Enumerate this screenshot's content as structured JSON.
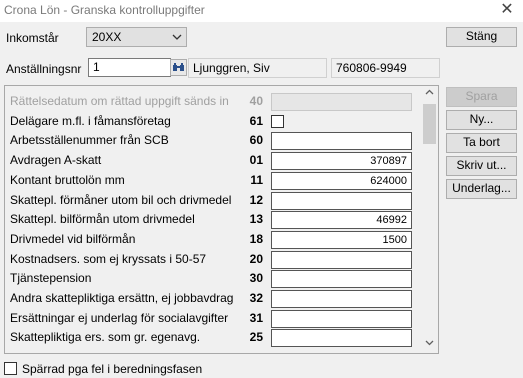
{
  "window": {
    "title": "Crona Lön - Granska kontrolluppgifter",
    "close_glyph": "✕"
  },
  "header": {
    "income_year_label": "Inkomstår",
    "income_year_value": "20XX",
    "close_button": "Stäng",
    "employee_no_label": "Anställningsnr",
    "employee_no_value": "1",
    "employee_name": "Ljunggren, Siv",
    "personal_id": "760806-9949"
  },
  "side_buttons": {
    "save": "Spara",
    "new": "Ny...",
    "delete": "Ta bort",
    "print": "Skriv ut...",
    "basis": "Underlag..."
  },
  "rows": [
    {
      "label": "Rättelsedatum om rättad uppgift sänds in",
      "code": "40",
      "value": "",
      "kind": "disabled"
    },
    {
      "label": "Delägare m.fl. i fåmansföretag",
      "code": "61",
      "value": "",
      "kind": "checkbox"
    },
    {
      "label": "Arbetsställenummer från SCB",
      "code": "60",
      "value": "",
      "kind": "text"
    },
    {
      "label": "Avdragen A-skatt",
      "code": "01",
      "value": "370897",
      "kind": "text"
    },
    {
      "label": "Kontant bruttolön mm",
      "code": "11",
      "value": "624000",
      "kind": "text"
    },
    {
      "label": "Skattepl. förmåner utom bil och drivmedel",
      "code": "12",
      "value": "",
      "kind": "text"
    },
    {
      "label": "Skattepl. bilförmån utom drivmedel",
      "code": "13",
      "value": "46992",
      "kind": "text"
    },
    {
      "label": "Drivmedel vid bilförmån",
      "code": "18",
      "value": "1500",
      "kind": "text"
    },
    {
      "label": "Kostnadsers. som ej kryssats i 50-57",
      "code": "20",
      "value": "",
      "kind": "text"
    },
    {
      "label": "Tjänstepension",
      "code": "30",
      "value": "",
      "kind": "text"
    },
    {
      "label": "Andra skattepliktiga ersättn, ej jobbavdrag",
      "code": "32",
      "value": "",
      "kind": "text"
    },
    {
      "label": "Ersättningar ej underlag för socialavgifter",
      "code": "31",
      "value": "",
      "kind": "text"
    },
    {
      "label": "Skattepliktiga ers. som gr. egenavg.",
      "code": "25",
      "value": "",
      "kind": "text"
    }
  ],
  "footer": {
    "blocked_label": "Spärrad pga fel i beredningsfasen"
  },
  "icons": {
    "dropdown": "chevron-down-icon",
    "lookup": "binoculars-icon",
    "scroll_up": "scroll-up-icon",
    "scroll_down": "scroll-down-icon"
  }
}
